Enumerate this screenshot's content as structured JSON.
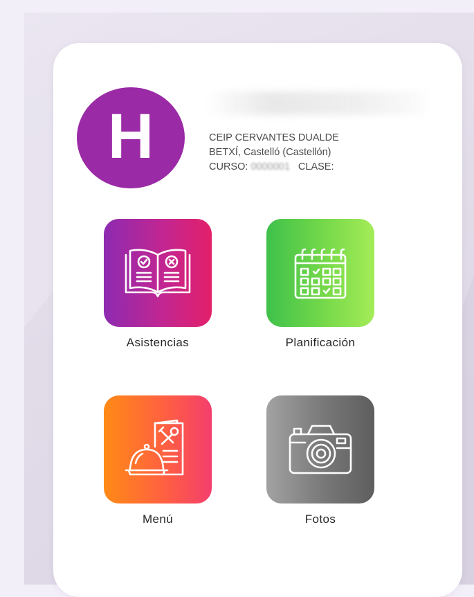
{
  "profile": {
    "avatar_letter": "H",
    "avatar_color": "#9a2aa6",
    "school_name": "CEIP CERVANTES DUALDE",
    "location": "BETXÍ, Castelló (Castellón)",
    "course_label": "CURSO:",
    "course_value": "0000001",
    "class_label": "CLASE:"
  },
  "tiles": [
    {
      "label": "Asistencias",
      "icon": "attendance-book-icon",
      "colors": [
        "#8d2bb1",
        "#e3206a"
      ]
    },
    {
      "label": "Planificación",
      "icon": "calendar-icon",
      "colors": [
        "#3fc14b",
        "#a4ec58"
      ]
    },
    {
      "label": "Menú",
      "icon": "menu-cloche-icon",
      "colors": [
        "#ff8a16",
        "#f43e6d"
      ]
    },
    {
      "label": "Fotos",
      "icon": "camera-icon",
      "colors": [
        "#a2a2a2",
        "#5e5e5e"
      ]
    }
  ]
}
